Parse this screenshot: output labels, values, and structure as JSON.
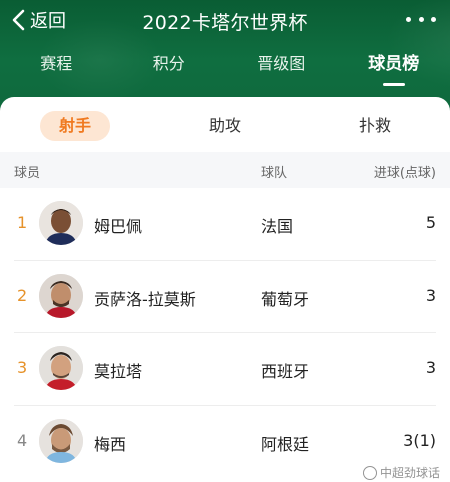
{
  "header": {
    "back_label": "返回",
    "title": "2022卡塔尔世界杯",
    "tabs": [
      {
        "label": "赛程"
      },
      {
        "label": "积分"
      },
      {
        "label": "晋级图"
      },
      {
        "label": "球员榜"
      }
    ],
    "active_tab": "球员榜"
  },
  "subtabs": [
    {
      "label": "射手"
    },
    {
      "label": "助攻"
    },
    {
      "label": "扑救"
    }
  ],
  "active_subtab": "射手",
  "table": {
    "columns": {
      "player": "球员",
      "team": "球队",
      "goals": "进球(点球)"
    },
    "rows": [
      {
        "rank": "1",
        "player": "姆巴佩",
        "team": "法国",
        "goals": "5"
      },
      {
        "rank": "2",
        "player": "贡萨洛-拉莫斯",
        "team": "葡萄牙",
        "goals": "3"
      },
      {
        "rank": "3",
        "player": "莫拉塔",
        "team": "西班牙",
        "goals": "3"
      },
      {
        "rank": "4",
        "player": "梅西",
        "team": "阿根廷",
        "goals": "3(1)"
      }
    ]
  },
  "watermark": "中超劲球话",
  "colors": {
    "header_green": "#0f6a3e",
    "accent_orange": "#f07a21",
    "subtab_active_bg": "#fde6d3"
  }
}
